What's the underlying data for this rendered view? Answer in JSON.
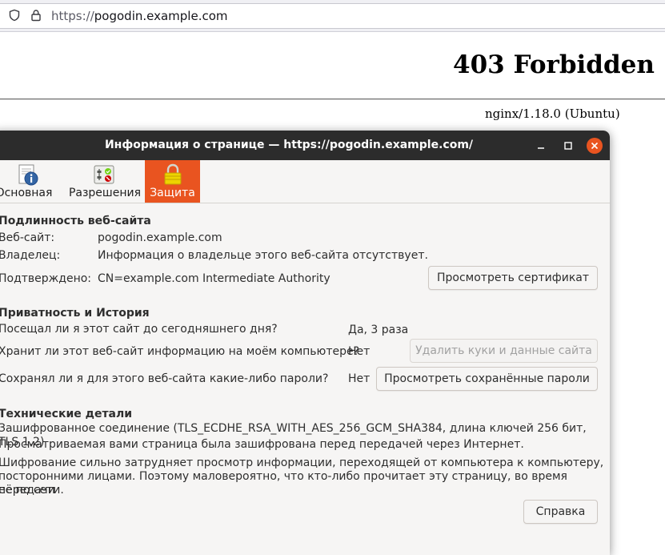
{
  "browser": {
    "url_scheme": "https://",
    "url_host": "pogodin.example.com",
    "icons": [
      "shield-icon",
      "lock-icon"
    ]
  },
  "page": {
    "heading": "403 Forbidden",
    "server": "nginx/1.18.0 (Ubuntu)"
  },
  "dialog": {
    "title": "Информация о странице — https://pogodin.example.com/",
    "window_buttons": [
      "minimize-icon",
      "maximize-icon",
      "close-icon"
    ],
    "tabs": [
      {
        "label": "Основная",
        "icon": "info-icon",
        "active": false
      },
      {
        "label": "Разрешения",
        "icon": "permissions-icon",
        "active": false
      },
      {
        "label": "Защита",
        "icon": "padlock-icon",
        "active": true
      }
    ],
    "identity": {
      "title": "Подлинность веб-сайта",
      "website_label": "Веб-сайт:",
      "website_value": "pogodin.example.com",
      "owner_label": "Владелец:",
      "owner_value": "Информация о владельце этого веб-сайта отсутствует.",
      "verified_label": "Подтверждено:",
      "verified_value": "CN=example.com Intermediate Authority",
      "view_cert_button": "Просмотреть сертификат"
    },
    "privacy": {
      "title": "Приватность и История",
      "visited_q": "Посещал ли я этот сайт до сегодняшнего дня?",
      "visited_a": "Да, 3 раза",
      "stores_q": "Хранит ли этот веб-сайт информацию на моём компьютере?",
      "stores_a": "Нет",
      "clear_cookies_button": "Удалить куки и данные сайта",
      "passwords_q": "Сохранял ли я для этого веб-сайта какие-либо пароли?",
      "passwords_a": "Нет",
      "view_passwords_button": "Просмотреть сохранённые пароли"
    },
    "technical": {
      "title": "Технические детали",
      "line1": "Зашифрованное соединение (TLS_ECDHE_RSA_WITH_AES_256_GCM_SHA384, длина ключей 256 бит, TLS 1.2)",
      "line2": "Просматриваемая вами страница была зашифрована перед передачей через Интернет.",
      "line3a": "Шифрование сильно затрудняет просмотр информации, переходящей от компьютера к компьютеру,",
      "line3b": "посторонними лицами. Поэтому маловероятно, что кто-либо прочитает эту страницу, во время передачи",
      "line3c": "её по сети."
    },
    "help_button": "Справка",
    "colors": {
      "accent": "#e95420",
      "titlebar": "#2c2c2c",
      "dialog_bg": "#f6f5f4"
    }
  }
}
